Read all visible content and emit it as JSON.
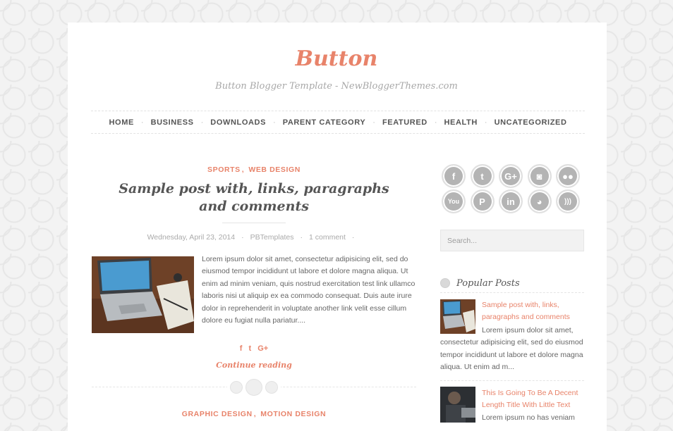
{
  "site": {
    "title": "Button",
    "description": "Button Blogger Template - NewBloggerThemes.com"
  },
  "nav": {
    "items": [
      "HOME",
      "BUSINESS",
      "DOWNLOADS",
      "PARENT CATEGORY",
      "FEATURED",
      "HEALTH",
      "UNCATEGORIZED"
    ],
    "separator": "·"
  },
  "post": {
    "categories": [
      "SPORTS",
      "WEB DESIGN"
    ],
    "comma": ",",
    "title": "Sample post with, links, paragraphs and comments",
    "date": "Wednesday, April 23, 2014",
    "author": "PBTemplates",
    "comments": "1 comment",
    "meta_dot": "·",
    "excerpt": "Lorem ipsum dolor sit amet, consectetur adipisicing elit, sed do eiusmod tempor incididunt ut labore et dolore magna aliqua. Ut enim ad minim veniam, quis nostrud exercitation test link ullamco laboris nisi ut aliquip ex ea commodo consequat. Duis aute irure dolor in reprehenderit in voluptate another link velit esse cillum dolore eu fugiat nulla pariatur....",
    "share": [
      "f",
      "t",
      "G+"
    ],
    "continue_label": "Continue reading",
    "share_icons": [
      "facebook-icon",
      "twitter-icon",
      "google-plus-icon"
    ]
  },
  "post2": {
    "categories": [
      "GRAPHIC DESIGN",
      "MOTION DESIGN"
    ]
  },
  "sidebar": {
    "social": [
      {
        "glyph": "f",
        "icon": "facebook-icon"
      },
      {
        "glyph": "t",
        "icon": "twitter-icon"
      },
      {
        "glyph": "G+",
        "icon": "google-plus-icon"
      },
      {
        "glyph": "◙",
        "icon": "instagram-icon"
      },
      {
        "glyph": "●●",
        "icon": "flickr-icon"
      },
      {
        "glyph": "You",
        "icon": "youtube-icon"
      },
      {
        "glyph": "P",
        "icon": "pinterest-icon"
      },
      {
        "glyph": "in",
        "icon": "linkedin-icon"
      },
      {
        "glyph": "◕",
        "icon": "github-icon"
      },
      {
        "glyph": ")))",
        "icon": "rss-icon"
      }
    ],
    "search_placeholder": "Search...",
    "popular_title": "Popular Posts",
    "popular": [
      {
        "title": "Sample post with, links, paragraphs and comments",
        "excerpt": "Lorem ipsum dolor sit amet, consectetur adipisicing elit, sed do eiusmod tempor incididunt ut labore et dolore magna aliqua. Ut enim ad m..."
      },
      {
        "title": "This Is Going To Be A Decent Length Title With Little Text",
        "excerpt": "Lorem ipsum no has veniam"
      }
    ]
  },
  "colors": {
    "accent": "#e8836a",
    "text": "#666666",
    "muted": "#aaaaaa"
  }
}
